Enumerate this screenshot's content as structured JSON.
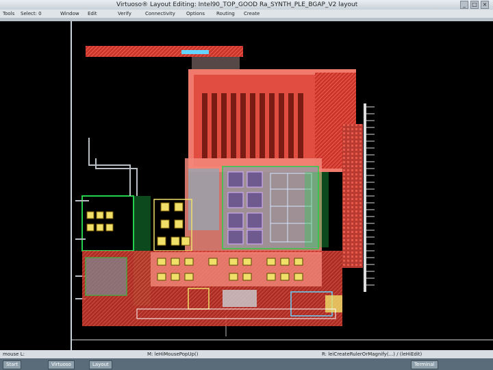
{
  "window": {
    "title": "Virtuoso® Layout Editing: Intel90_TOP_GOOD Ra_SYNTH_PLE_BGAP_V2 layout",
    "controls": [
      "_",
      "□",
      "×"
    ]
  },
  "menubar": {
    "items": [
      "Tools",
      "Select: 0",
      "Window",
      "Edit",
      "Verify",
      "Connectivity",
      "Options",
      "Routing",
      "Create"
    ]
  },
  "statusbar": {
    "left": "mouse L: ",
    "middle": "M: leHiMousePopUp()",
    "right": "R: leiCreateRulerOrMagnify(...) / (leHiEdit)"
  },
  "taskbar": {
    "items": [
      "Start",
      "Virtuoso",
      "Layout",
      "Terminal"
    ]
  },
  "colors": {
    "metal": "#e8473a",
    "metal_light": "#f3887b",
    "poly": "#23d14f",
    "diffusion": "#f0e06a",
    "via": "#64d4ff",
    "outline": "#ffffff",
    "background": "#000000"
  }
}
